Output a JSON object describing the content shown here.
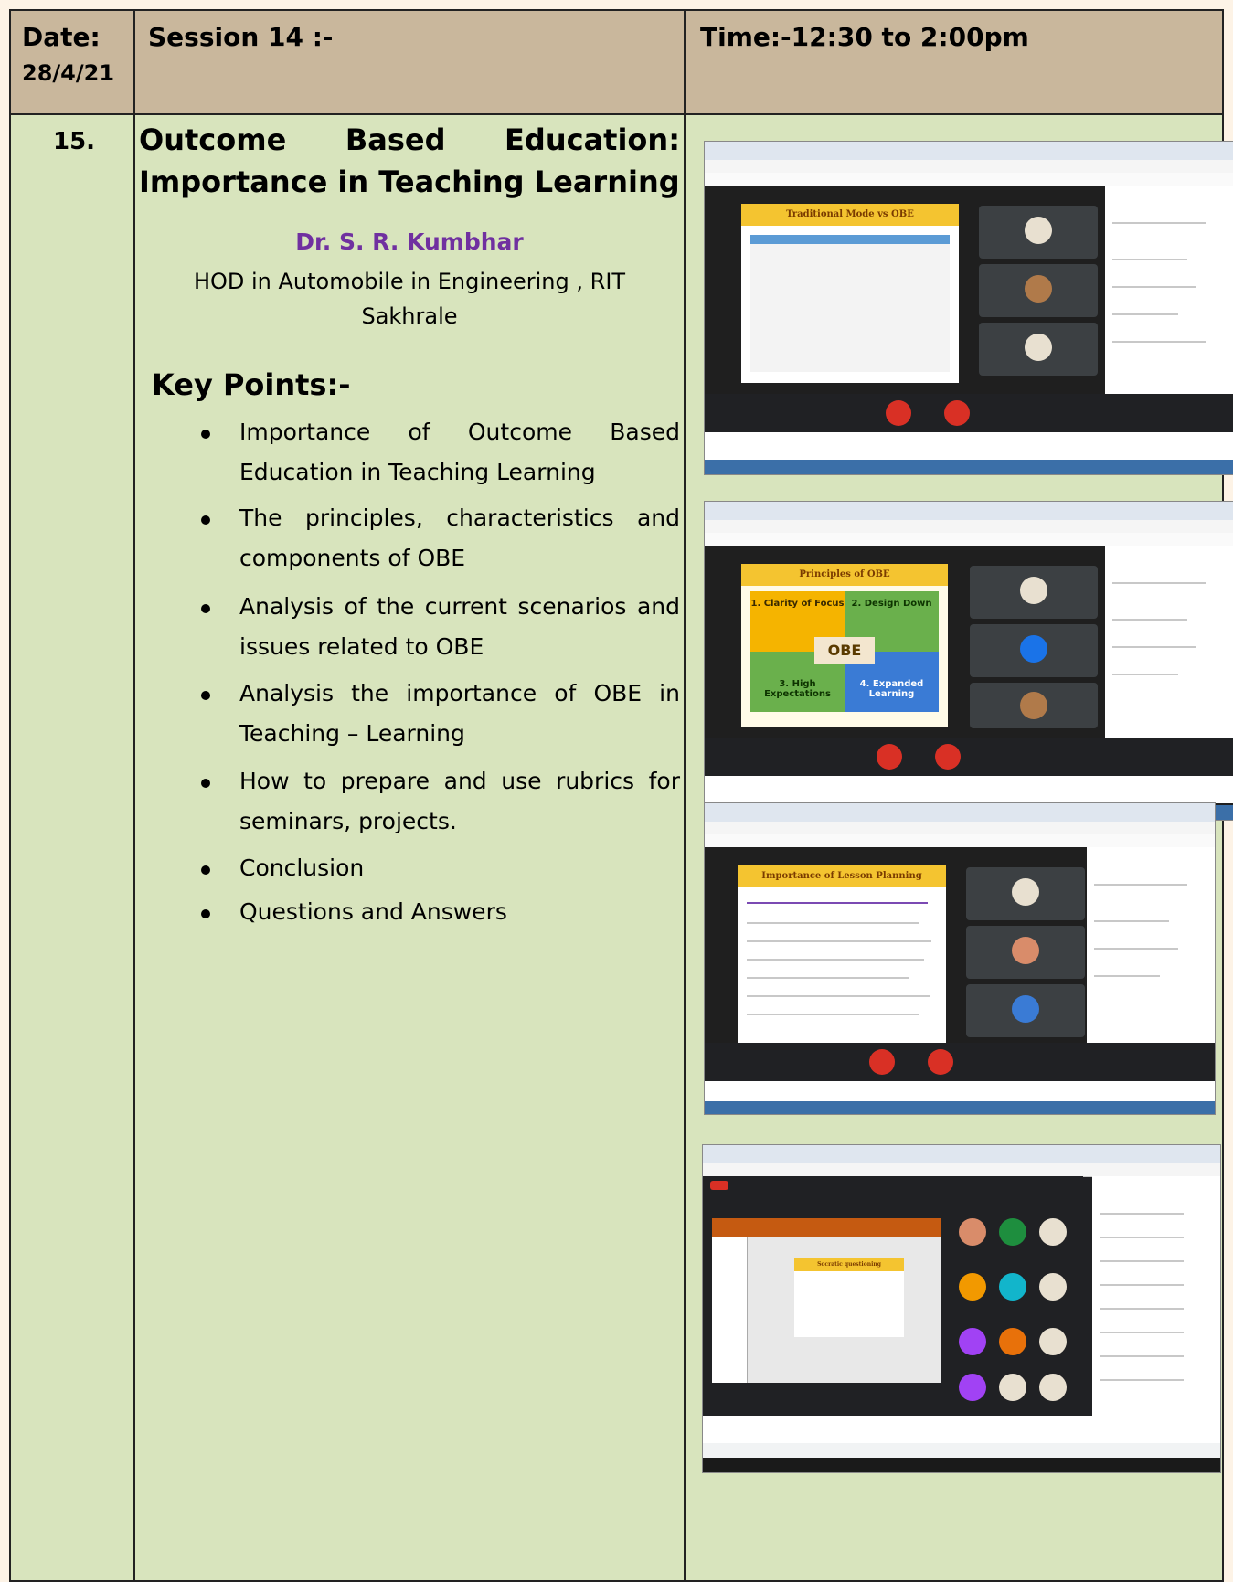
{
  "header": {
    "date_label": "Date:",
    "date_value": "28/4/21",
    "session": "Session 14 :-",
    "time": "Time:-12:30 to 2:00pm"
  },
  "row": {
    "number": "15.",
    "title_line1_words": [
      "Outcome",
      "Based",
      "Education:"
    ],
    "title_line2": "Importance in Teaching Learning",
    "speaker_name": "Dr. S. R. Kumbhar",
    "speaker_role_line1": "HOD in Automobile in Engineering , RIT",
    "speaker_role_line2": "Sakhrale",
    "key_points_heading": "Key Points:-",
    "points": [
      {
        "line1_words": [
          "Importance",
          "of",
          "Outcome",
          "Based"
        ],
        "line2": "Education in Teaching Learning"
      },
      {
        "line1_words": [
          "The",
          "principles,",
          "characteristics",
          "and"
        ],
        "line2": "components of OBE"
      },
      {
        "line1_words": [
          "Analysis",
          "of",
          "the",
          "current",
          "scenarios",
          "and"
        ],
        "line2": "issues related to OBE"
      },
      {
        "line1_words": [
          "Analysis",
          "the",
          "importance",
          "of",
          "OBE",
          "in"
        ],
        "line2": "Teaching – Learning"
      },
      {
        "line1_words": [
          "How",
          "to",
          "prepare",
          "and",
          "use",
          "rubrics",
          "for"
        ],
        "line2": "seminars, projects."
      },
      {
        "line1_words": [
          "Conclusion"
        ],
        "line2": ""
      },
      {
        "line1_words": [
          "Questions and Answers"
        ],
        "line2": ""
      }
    ]
  },
  "screenshots": [
    {
      "slide_title": "Traditional Mode vs OBE"
    },
    {
      "slide_title": "Principles of OBE",
      "quad": [
        "1. Clarity of Focus",
        "2. Design Down",
        "3. High Expectations",
        "4. Expanded Learning"
      ],
      "center": "OBE"
    },
    {
      "slide_title": "Importance of Lesson Planning"
    },
    {
      "slide_title": "Socratic questioning"
    }
  ],
  "colors": {
    "header_bg": "#c9b79c",
    "body_bg": "#d8e4bd",
    "speaker": "#7030a0",
    "page_bg": "#fdf3e6"
  }
}
